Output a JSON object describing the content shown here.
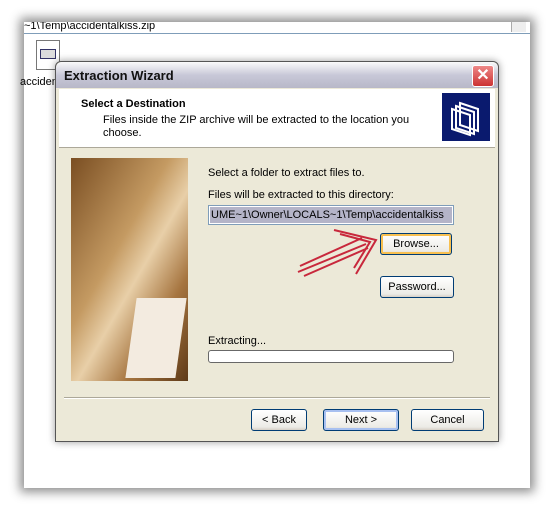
{
  "explorer": {
    "address": "~1\\Temp\\accidentalkiss.zip",
    "file_label": "accident"
  },
  "dialog": {
    "title": "Extraction Wizard",
    "close_symbol": "✕",
    "header": {
      "title": "Select a Destination",
      "description": "Files inside the ZIP archive will be extracted to the location you choose.",
      "icon": "folders-icon"
    },
    "select_label": "Select a folder to extract files to.",
    "dir_label": "Files will be extracted to this directory:",
    "dir_value": "UME~1\\Owner\\LOCALS~1\\Temp\\accidentalkiss",
    "browse_label": "Browse...",
    "password_label": "Password...",
    "extracting_label": "Extracting...",
    "progress": 0,
    "back_label": "< Back",
    "next_label": "Next >",
    "cancel_label": "Cancel",
    "annotation_color": "#c8283c"
  }
}
